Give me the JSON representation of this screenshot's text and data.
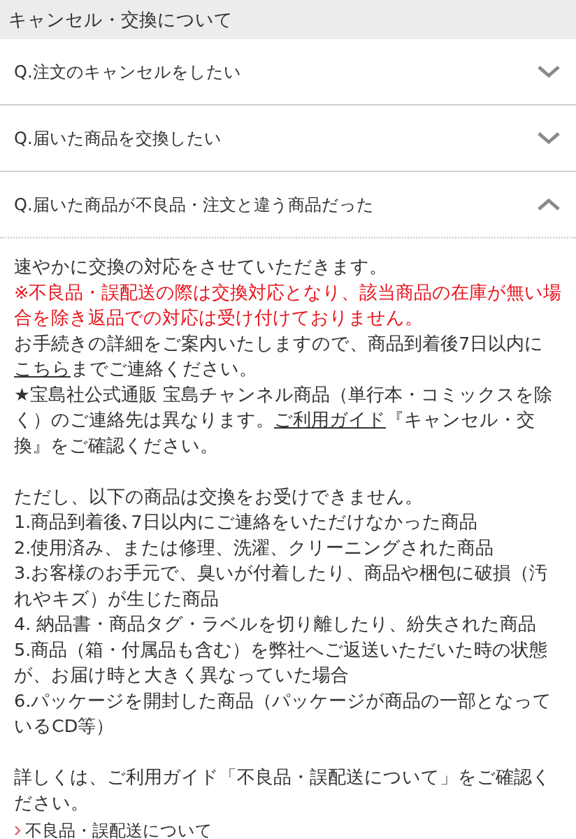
{
  "header": {
    "title": "キャンセル・交換について"
  },
  "faq": [
    {
      "question": "Q.注文のキャンセルをしたい",
      "expanded": false
    },
    {
      "question": "Q.届いた商品を交換したい",
      "expanded": false
    },
    {
      "question": "Q.届いた商品が不良品・注文と違う商品だった",
      "expanded": true
    }
  ],
  "answer": {
    "blocks": [
      {
        "kind": "text",
        "segments": [
          {
            "text": "速やかに交換の対応をさせていただきます。",
            "link": false
          }
        ]
      },
      {
        "kind": "warning",
        "segments": [
          {
            "text": "※不良品・誤配送の際は交換対応となり、該当商品の在庫が無い場合を除き返品での対応は受け付けておりません。",
            "link": false
          }
        ]
      },
      {
        "kind": "text",
        "segments": [
          {
            "text": "お手続きの詳細をご案内いたしますので、商品到着後7日以内に",
            "link": false
          },
          {
            "text": "こちら",
            "link": true
          },
          {
            "text": "までご連絡ください。",
            "link": false
          }
        ]
      },
      {
        "kind": "text",
        "segments": [
          {
            "text": "★宝島社公式通販 宝島チャンネル商品（単行本・コミックスを除く）のご連絡先は異なります。",
            "link": false
          },
          {
            "text": "ご利用ガイド",
            "link": true
          },
          {
            "text": "『キャンセル・交換』をご確認ください。",
            "link": false
          }
        ]
      },
      {
        "kind": "gap"
      },
      {
        "kind": "text",
        "segments": [
          {
            "text": "ただし、以下の商品は交換をお受けできません。",
            "link": false
          }
        ]
      },
      {
        "kind": "item",
        "segments": [
          {
            "text": "1.商品到着後､7日以内にご連絡をいただけなかった商品",
            "link": false
          }
        ]
      },
      {
        "kind": "item",
        "segments": [
          {
            "text": "2.使用済み、または修理、洗濯、クリーニングされた商品",
            "link": false
          }
        ]
      },
      {
        "kind": "item",
        "segments": [
          {
            "text": "3.お客様のお手元で、臭いが付着したり、商品や梱包に破損（汚れやキズ）が生じた商品",
            "link": false
          }
        ]
      },
      {
        "kind": "item",
        "segments": [
          {
            "text": "4. 納品書・商品タグ・ラベルを切り離したり、紛失された商品",
            "link": false
          }
        ]
      },
      {
        "kind": "item",
        "segments": [
          {
            "text": "5.商品（箱・付属品も含む）を弊社へご返送いただいた時の状態が、お届け時と大きく異なっていた場合",
            "link": false
          }
        ]
      },
      {
        "kind": "item",
        "segments": [
          {
            "text": "6.パッケージを開封した商品（パッケージが商品の一部となっているCD等）",
            "link": false
          }
        ]
      },
      {
        "kind": "gap"
      },
      {
        "kind": "text",
        "segments": [
          {
            "text": "詳しくは、ご利用ガイド「不良品・誤配送について」をご確認ください。",
            "link": false
          }
        ]
      }
    ],
    "link": "不良品・誤配送について"
  }
}
